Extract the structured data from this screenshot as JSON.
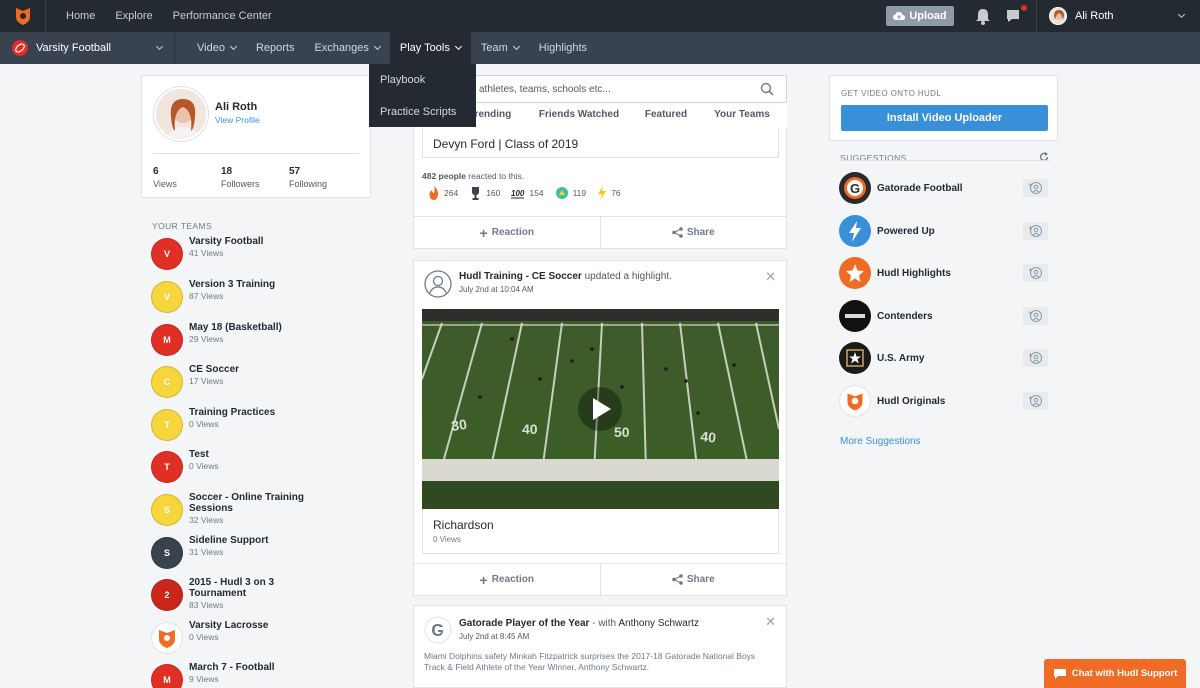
{
  "topnav": {
    "home": "Home",
    "explore": "Explore",
    "performance": "Performance Center",
    "upload": "Upload",
    "user_name": "Ali Roth"
  },
  "subnav": {
    "team": "Varsity Football",
    "items": [
      "Video",
      "Reports",
      "Exchanges",
      "Play Tools",
      "Team",
      "Highlights"
    ]
  },
  "dropdown": {
    "items": [
      "Playbook",
      "Practice Scripts"
    ]
  },
  "profile": {
    "name": "Ali Roth",
    "view_profile": "View Profile",
    "stats": [
      {
        "n": "6",
        "l": "Views"
      },
      {
        "n": "18",
        "l": "Followers"
      },
      {
        "n": "57",
        "l": "Following"
      }
    ]
  },
  "teams": {
    "label": "YOUR TEAMS",
    "items": [
      {
        "letter": "V",
        "name": "Varsity Football",
        "views": "41 Views",
        "color": "#e02f25"
      },
      {
        "letter": "V",
        "name": "Version 3 Training",
        "views": "87 Views",
        "color": "#f7d53c"
      },
      {
        "letter": "M",
        "name": "May 18 (Basketball)",
        "views": "29 Views",
        "color": "#e02f25"
      },
      {
        "letter": "C",
        "name": "CE Soccer",
        "views": "17 Views",
        "color": "#f7d53c"
      },
      {
        "letter": "T",
        "name": "Training Practices",
        "views": "0 Views",
        "color": "#f7d53c"
      },
      {
        "letter": "T",
        "name": "Test",
        "views": "0 Views",
        "color": "#e02f25"
      },
      {
        "letter": "S",
        "name": "Soccer - Online Training Sessions",
        "views": "32 Views",
        "color": "#f7d53c"
      },
      {
        "letter": "S",
        "name": "Sideline Support",
        "views": "31 Views",
        "color": "#38434f"
      },
      {
        "letter": "2",
        "name": "2015 - Hudl 3 on 3 Tournament",
        "views": "83 Views",
        "color": "#c9261c"
      },
      {
        "letter": "",
        "name": "Varsity Lacrosse",
        "views": "0 Views",
        "color": "#ffffff"
      },
      {
        "letter": "M",
        "name": "March 7 - Football",
        "views": "9 Views",
        "color": "#e02f25"
      }
    ]
  },
  "search": {
    "placeholder": "athletes, teams, schools etc..."
  },
  "tabs": [
    "Trending",
    "Friends Watched",
    "Featured",
    "Your Teams"
  ],
  "feed1": {
    "title": "Devyn Ford | Class of 2019",
    "reacted_count": "482 people",
    "reacted_text": " reacted to this.",
    "reactions": [
      "264",
      "160",
      "154",
      "119",
      "76"
    ],
    "reaction_label": "Reaction",
    "share_label": "Share"
  },
  "feed2": {
    "author": "Hudl Training - CE Soccer",
    "action": " updated a highlight.",
    "date": "July 2nd at 10:04 AM",
    "video_title": "Richardson",
    "views": "0 Views",
    "yard_labels": [
      "30",
      "40",
      "50",
      "40"
    ],
    "reaction_label": "Reaction",
    "share_label": "Share"
  },
  "feed3": {
    "author": "Gatorade Player of the Year",
    "with": " - with ",
    "with_name": "Anthony Schwartz",
    "date": "July 2nd at 8:45 AM",
    "text": "Miami Dolphins safety Minkah Fitzpatrick surprises the 2017-18 Gatorade National Boys Track & Field Athlete of the Year Winner, Anthony Schwartz."
  },
  "uploader": {
    "label": "GET VIDEO ONTO HUDL",
    "button": "Install Video Uploader"
  },
  "suggestions": {
    "label": "SUGGESTIONS",
    "items": [
      "Gatorade Football",
      "Powered Up",
      "Hudl Highlights",
      "Contenders",
      "U.S. Army",
      "Hudl Originals"
    ],
    "more": "More Suggestions"
  },
  "chat": {
    "label": "Chat with Hudl Support"
  },
  "colors": {
    "accent": "#3a8fd9",
    "orange": "#f06b24",
    "nav": "#232a31",
    "subnav": "#38434f"
  }
}
